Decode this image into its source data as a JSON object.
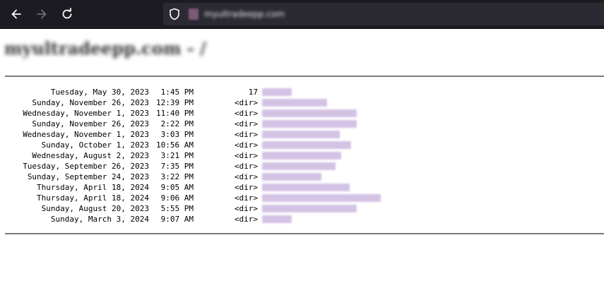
{
  "browser": {
    "back_icon": "arrow-left-icon",
    "forward_icon": "arrow-right-icon",
    "reload_icon": "reload-icon",
    "shield_icon": "shield-icon",
    "url": "myultradeepp.com"
  },
  "page": {
    "heading": "myultradeepp.com - /"
  },
  "listing": [
    {
      "date": "Tuesday, May 30, 2023",
      "time": "1:45 PM",
      "size": "17",
      "name": "LICENSE"
    },
    {
      "date": "Sunday, November 26, 2023",
      "time": "12:39 PM",
      "size": "<dir>",
      "name": "sliced-workspace"
    },
    {
      "date": "Wednesday, November 1, 2023",
      "time": "11:40 PM",
      "size": "<dir>",
      "name": "architecture-handbook-2023"
    },
    {
      "date": "Sunday, November 26, 2023",
      "time": "2:22 PM",
      "size": "<dir>",
      "name": "deep-learning-notes-backup"
    },
    {
      "date": "Wednesday, November 1, 2023",
      "time": "3:03 PM",
      "size": "<dir>",
      "name": "build-artifacts-old"
    },
    {
      "date": "Sunday, October 1, 2023",
      "time": "10:56 AM",
      "size": "<dir>",
      "name": "screenshots-and-exports"
    },
    {
      "date": "Wednesday, August 2, 2023",
      "time": "3:21 PM",
      "size": "<dir>",
      "name": "experiment-configs"
    },
    {
      "date": "Tuesday, September 26, 2023",
      "time": "7:35 PM",
      "size": "<dir>",
      "name": "model-checkpoints"
    },
    {
      "date": "Sunday, September 24, 2023",
      "time": "3:22 PM",
      "size": "<dir>",
      "name": "dataset-index"
    },
    {
      "date": "Thursday, April 18, 2024",
      "time": "9:05 AM",
      "size": "<dir>",
      "name": "research-drafts-q1"
    },
    {
      "date": "Thursday, April 18, 2024",
      "time": "9:06 AM",
      "size": "<dir>",
      "name": "research-drafts-q1-final-v2"
    },
    {
      "date": "Sunday, August 20, 2023",
      "time": "5:55 PM",
      "size": "<dir>",
      "name": "shared-project-files"
    },
    {
      "date": "Sunday, March 3, 2024",
      "time": "9:07 AM",
      "size": "<dir>",
      "name": "vendor"
    }
  ]
}
